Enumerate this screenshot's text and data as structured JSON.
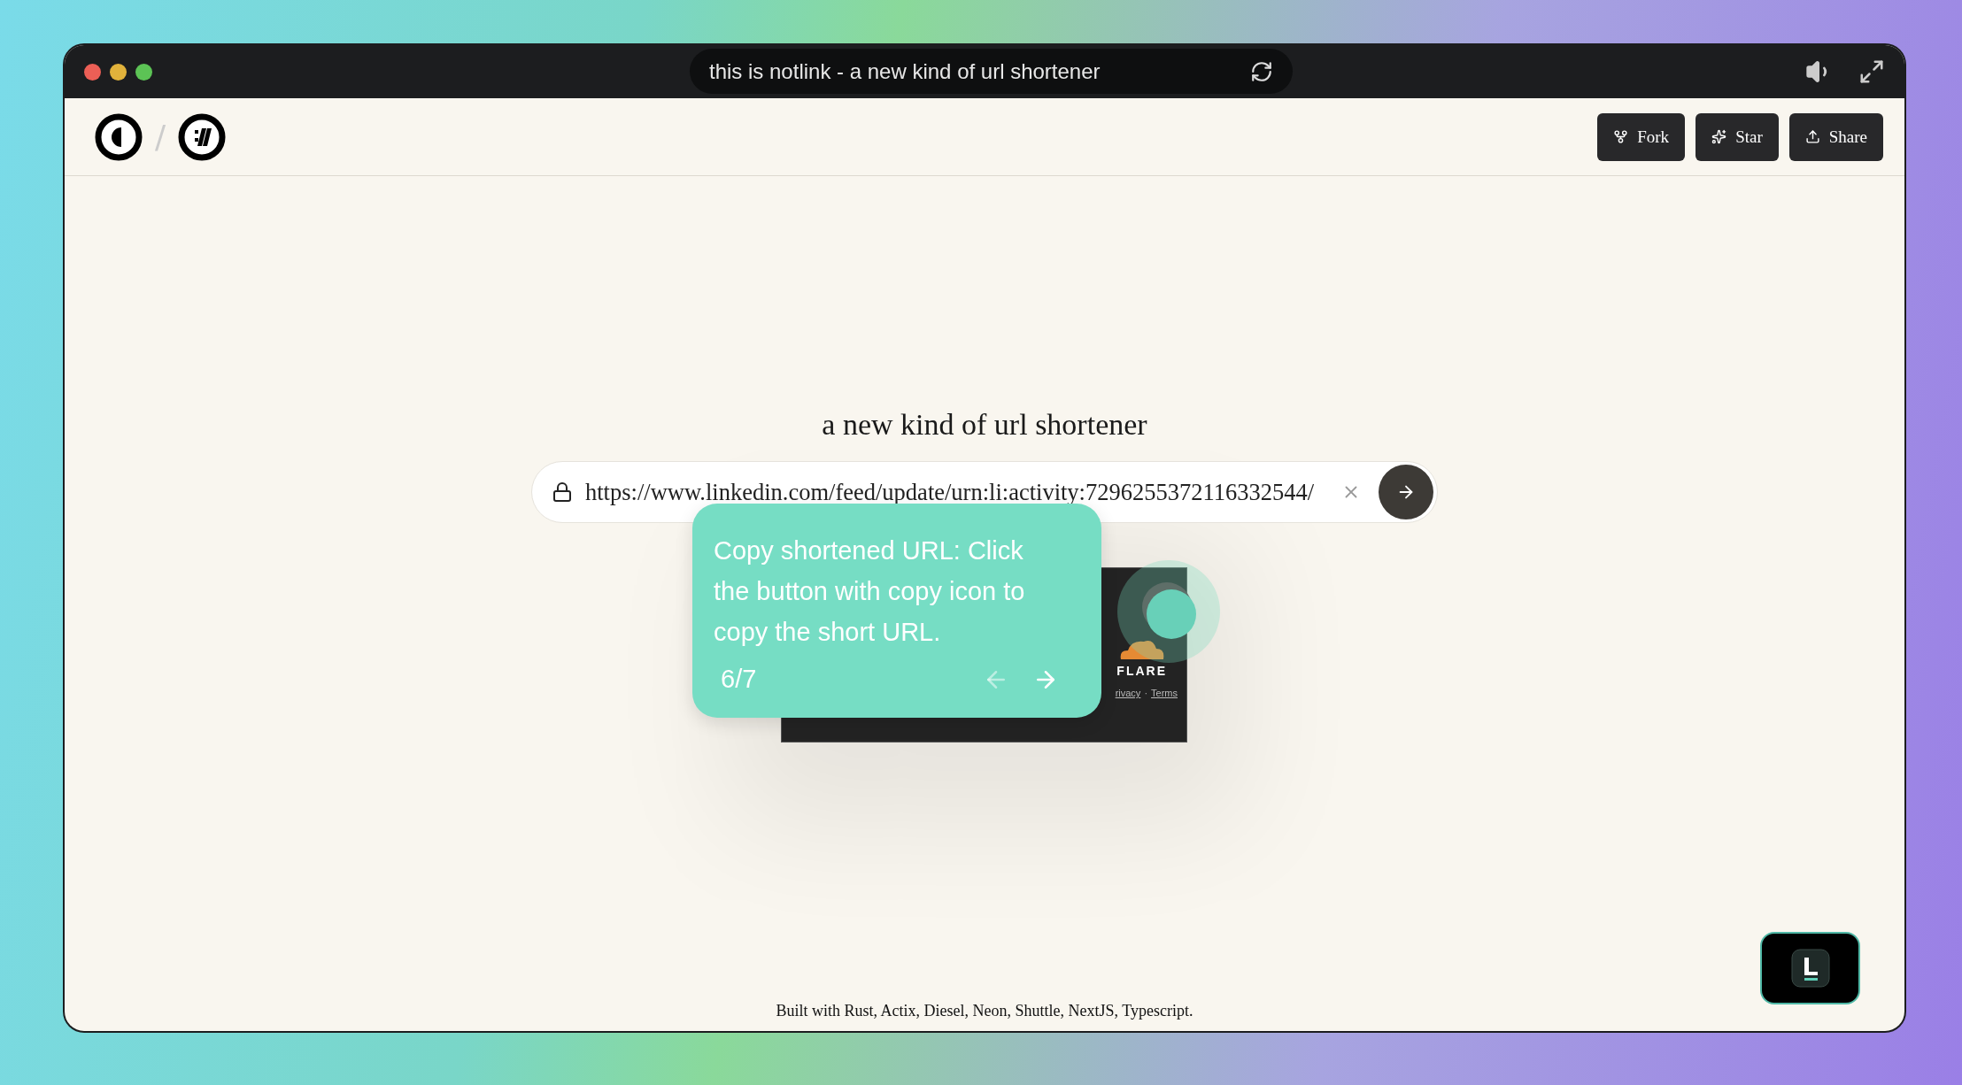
{
  "titlebar": {
    "address": "this is notlink - a new kind of url shortener"
  },
  "header": {
    "separator": "/",
    "actions": [
      {
        "label": "Fork",
        "kind": "fork"
      },
      {
        "label": "Star",
        "kind": "star"
      },
      {
        "label": "Share",
        "kind": "share"
      }
    ]
  },
  "heading": "a new kind of url shortener",
  "url_input": {
    "value": "https://www.linkedin.com/feed/update/urn:li:activity:7296255372116332544/"
  },
  "tour": {
    "text": "Copy shortened URL: Click the button with copy icon to copy the short URL.",
    "step": "6/7",
    "back_enabled": false,
    "next_enabled": true
  },
  "captcha_widget": {
    "brand": "FLARE",
    "links": [
      "rivacy",
      "Terms"
    ],
    "link_separator": "·"
  },
  "footer": "Built with Rust, Actix, Diesel, Neon, Shuttle, NextJS, Typescript."
}
